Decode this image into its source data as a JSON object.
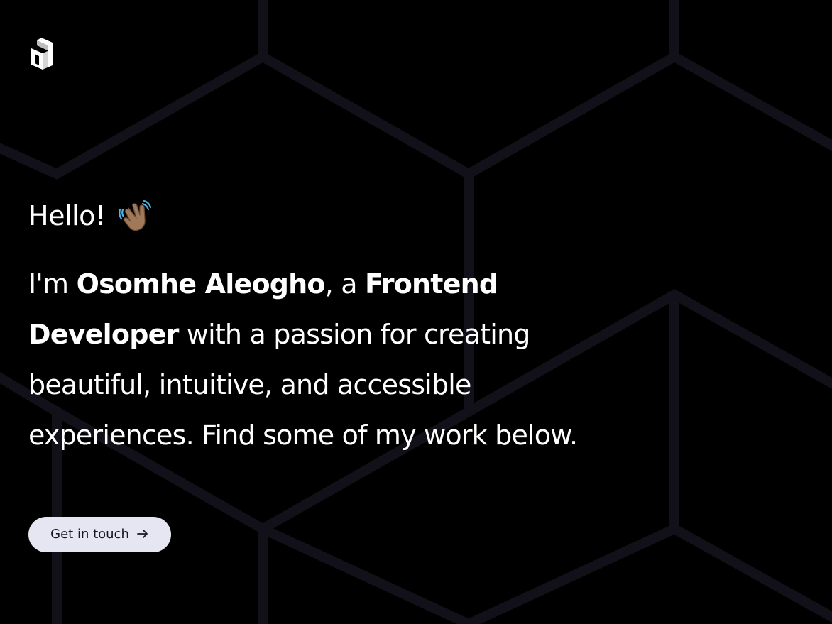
{
  "colors": {
    "background": "#000000",
    "pattern_stroke": "#121018",
    "text": "#ffffff",
    "button_bg": "#e6e6f2",
    "button_text": "#16161d"
  },
  "logo": {
    "icon": "logo-icon"
  },
  "hero": {
    "greeting": "Hello!",
    "greeting_icon": "waving-hand-icon",
    "intro": {
      "prefix": "I'm ",
      "name": "Osomhe Aleogho",
      "middle": ", a ",
      "role": "Frontend Developer",
      "suffix": " with a passion for creating beautiful, intuitive, and accessible experiences. Find some of my work below."
    }
  },
  "cta": {
    "label": "Get in touch",
    "icon": "arrow-right-icon"
  }
}
